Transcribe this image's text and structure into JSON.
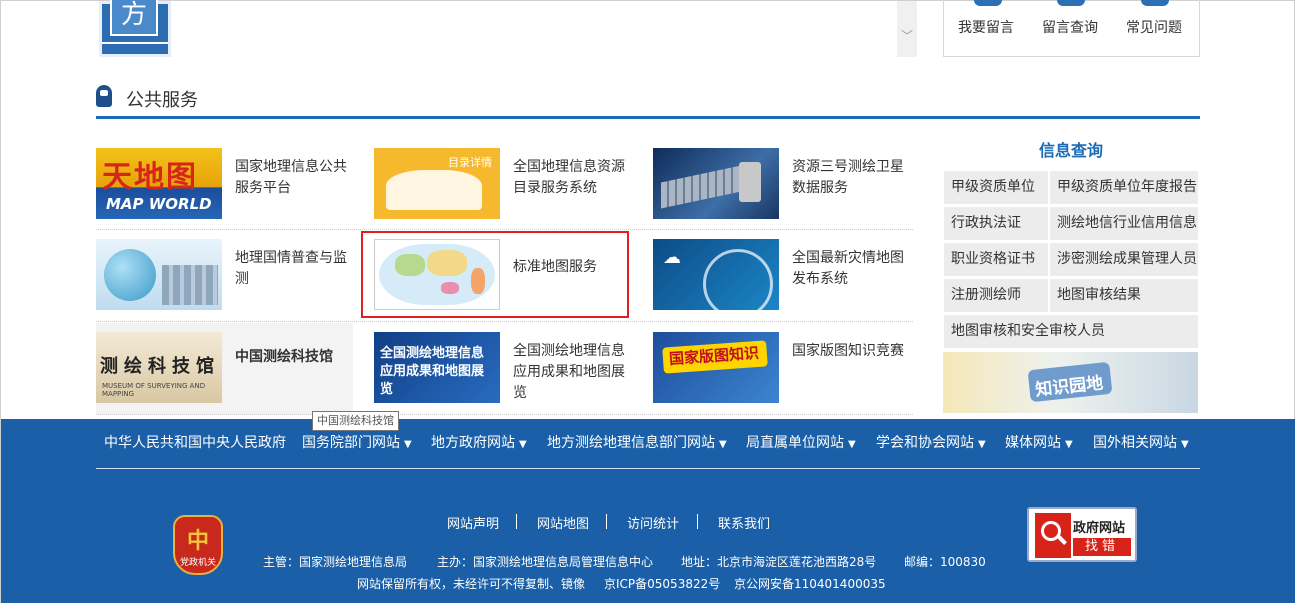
{
  "top": {
    "logo_char": "方",
    "scroll_glyph": "﹀",
    "message_buttons": [
      "我要留言",
      "留言查询",
      "常见问题"
    ]
  },
  "section": {
    "title": "公共服务"
  },
  "services": [
    {
      "label": "国家地理信息公共服务平台",
      "thumb_text": "天地图",
      "thumb_sub": "MAP WORLD"
    },
    {
      "label": "全国地理信息资源目录服务系统",
      "thumb_text": "目录详情"
    },
    {
      "label": "资源三号测绘卫星数据服务"
    },
    {
      "label": "地理国情普查与监测"
    },
    {
      "label": "标准地图服务"
    },
    {
      "label": "全国最新灾情地图发布系统"
    },
    {
      "label": "中国测绘科技馆",
      "thumb_text": "测绘科技馆"
    },
    {
      "label": "全国测绘地理信息应用成果和地图展览",
      "thumb_text": "全国测绘地理信息应用成果和地图展览"
    },
    {
      "label": "国家版图知识竞赛",
      "thumb_text": "国家版图知识"
    }
  ],
  "tooltip": "中国测绘科技馆",
  "info_query": {
    "title": "信息查询",
    "items": [
      "甲级资质单位",
      "甲级资质单位年度报告",
      "行政执法证",
      "测绘地信行业信用信息",
      "职业资格证书",
      "涉密测绘成果管理人员",
      "注册测绘师",
      "地图审核结果",
      "地图审核和安全审校人员"
    ],
    "banner": "知识园地"
  },
  "footer": {
    "links": [
      {
        "label": "中华人民共和国中央人民政府",
        "caret": ""
      },
      {
        "label": "国务院部门网站",
        "caret": "▼"
      },
      {
        "label": "地方政府网站",
        "caret": "▼"
      },
      {
        "label": "地方测绘地理信息部门网站",
        "caret": "▼"
      },
      {
        "label": "局直属单位网站",
        "caret": "▼"
      },
      {
        "label": "学会和协会网站",
        "caret": "▼"
      },
      {
        "label": "媒体网站",
        "caret": "▼"
      },
      {
        "label": "国外相关网站",
        "caret": "▼"
      }
    ],
    "emblem_symbol": "中",
    "emblem_label": "党政机关",
    "nav": [
      "网站声明",
      "网站地图",
      "访问统计",
      "联系我们"
    ],
    "sponsor": "主管：国家测绘地理信息局",
    "host": "主办：国家测绘地理信息局管理信息中心",
    "address": "地址：北京市海淀区莲花池西路28号",
    "postcode": "邮编：100830",
    "copyright": "网站保留所有权，未经许可不得复制、镜像",
    "icp": "京ICP备05053822号",
    "police": "京公网安备110401400035",
    "gov_button": {
      "line1": "政府网站",
      "line2": "找错"
    }
  }
}
